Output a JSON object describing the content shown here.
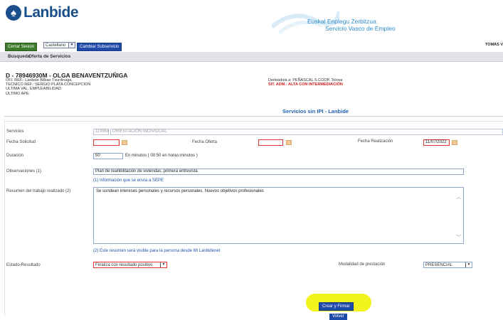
{
  "header": {
    "logo_text": "Lanbide",
    "basque_name": "Euskal Enplegu Zerbitzua",
    "spanish_name": "Servicio Vasco de Empleo"
  },
  "toolbar": {
    "logout_label": "Cerrar Sesion",
    "language_value": "Castellano",
    "change_service_label": "Cambiar Subservicio",
    "user_name": "TOMAS V"
  },
  "menu": {
    "items": [
      "Búsqueda",
      "Oferta de Servicios"
    ]
  },
  "person": {
    "name": "D - 78946930M - OLGA BENAVENTZUÑIGA",
    "lines": [
      "OFI. REF.: Lanbide Bilbao Txurdinaga",
      "TECNICO REF.: SERGIO PLATA CONCEPCION",
      "ULTIMA VAL. EMPLEABILIDAD:",
      "ÚLTIMO APE:"
    ],
    "entity": "Derleadola a: PEÑASCAL S.COOP. Tolosa",
    "status": "SIT. ADM.: ALTA CON INTERMEDIACIÓN"
  },
  "section_title": "Servicios sin IPI - Lanbide",
  "form": {
    "servicios_label": "Servicios",
    "servicios_code": "119958",
    "servicios_desc": "ORIENTACIÓN INDIVIDUAL",
    "fecha_solicitud_label": "Fecha Solicitud",
    "fecha_solicitud_value": "",
    "fecha_oferta_label": "Fecha Oferta",
    "fecha_oferta_value": "",
    "fecha_realizacion_label": "Fecha Realización",
    "fecha_realizacion_value": "11/07/2022",
    "duracion_label": "Duración",
    "duracion_value": "50",
    "duracion_unit": "En minutos   ( 00:50 en horas:minutos )",
    "observaciones_label": "Observaciones (1)",
    "observaciones_value": "Plan de reahbilitación de viviendas, primera entrevista",
    "note1": "(1) Información que se envía a SEPE",
    "resumen_label": "Resumen del trabajo realizado (2)",
    "resumen_value": "Se sondean intereses personales y recursos personales. Nuevos objetivos profesionales",
    "note2": "(2) Este resumen será visible para la persona desde Mi Lanbidenet",
    "estado_label": "Estado-Resultado",
    "estado_value": "Finaliza con resultado positivo",
    "modalidad_label": "Modalidad de prestación",
    "modalidad_value": "PRESENCIAL"
  },
  "actions": {
    "crear_label": "Crear y Firmar",
    "volver_label": "Volver"
  },
  "colors": {
    "brand": "#1a4f8b",
    "accent_blue": "#1f4aa8",
    "logout_green": "#3d7a2a",
    "error_red": "#d33333",
    "highlight": "#f2f21c"
  }
}
